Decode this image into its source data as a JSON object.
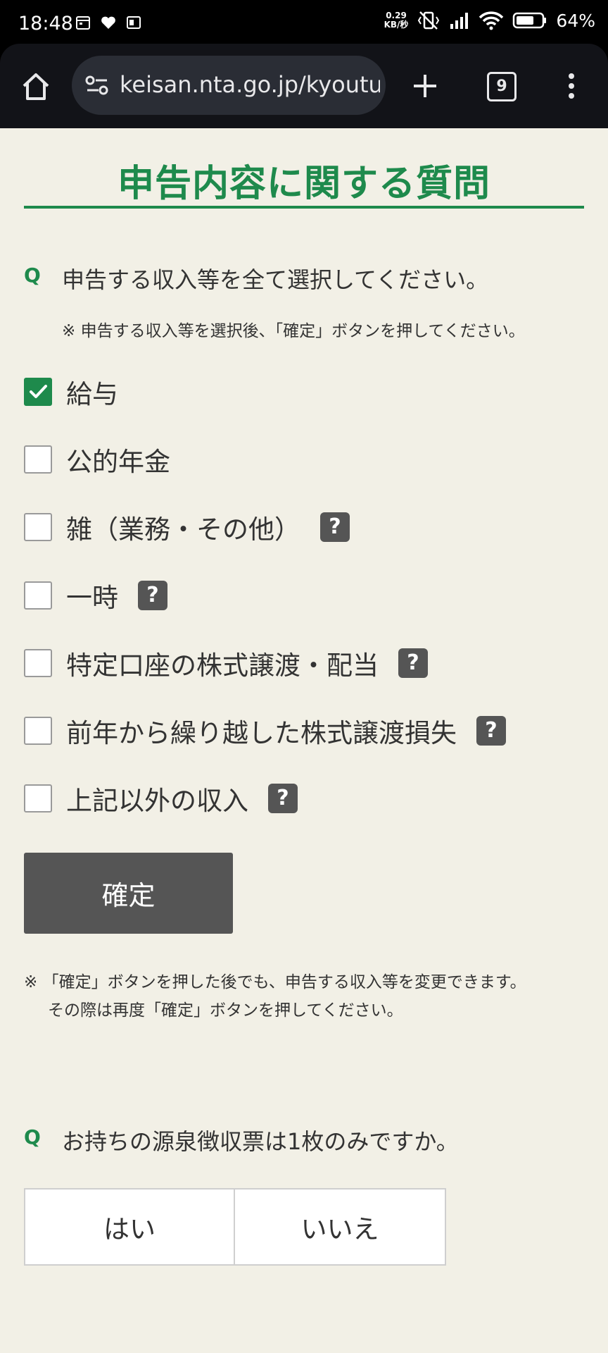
{
  "status_bar": {
    "time": "18:48",
    "net_speed_value": "0.29",
    "net_speed_unit": "KB/秒",
    "battery": "64%"
  },
  "browser": {
    "url": "keisan.nta.go.jp/kyoutu/",
    "tab_count": "9"
  },
  "page": {
    "title": "申告内容に関する質問",
    "q_mark": "Q",
    "question1": "申告する収入等を全て選択してください。",
    "question1_note": "※ 申告する収入等を選択後、「確定」ボタンを押してください。",
    "options": [
      {
        "label": "給与",
        "checked": true,
        "help": false
      },
      {
        "label": "公的年金",
        "checked": false,
        "help": false
      },
      {
        "label": "雑（業務・その他）",
        "checked": false,
        "help": true
      },
      {
        "label": "一時",
        "checked": false,
        "help": true
      },
      {
        "label": "特定口座の株式譲渡・配当",
        "checked": false,
        "help": true
      },
      {
        "label": "前年から繰り越した株式譲渡損失",
        "checked": false,
        "help": true
      },
      {
        "label": "上記以外の収入",
        "checked": false,
        "help": true
      }
    ],
    "help_glyph": "?",
    "confirm_label": "確定",
    "footnote_line1": "※ 「確定」ボタンを押した後でも、申告する収入等を変更できます。",
    "footnote_line2": "その際は再度「確定」ボタンを押してください。",
    "question2": "お持ちの源泉徴収票は1枚のみですか。",
    "yes_label": "はい",
    "no_label": "いいえ"
  },
  "colors": {
    "accent_green": "#1e8a4c",
    "button_gray": "#555555",
    "page_bg": "#f2f0e6"
  }
}
